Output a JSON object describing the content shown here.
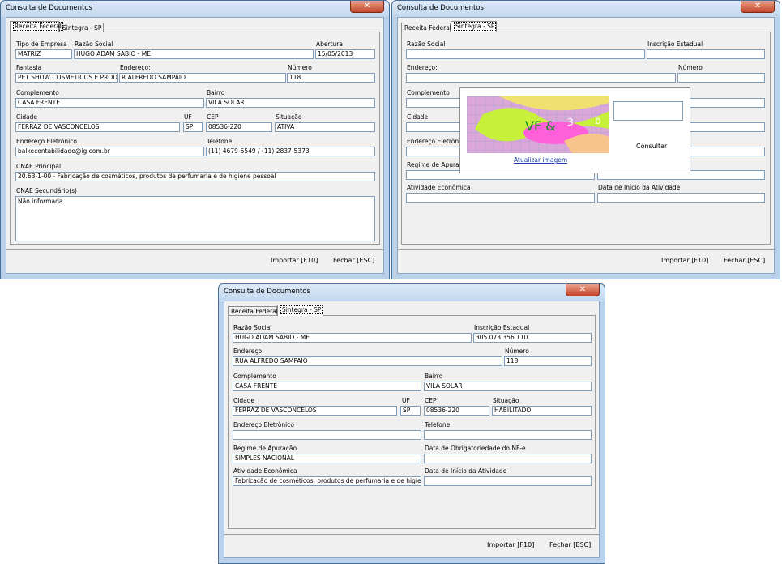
{
  "window_title": "Consulta de Documentos",
  "close_symbol": "✕",
  "tabs": {
    "receita": "Receita Federal",
    "sintegra": "Sintegra - SP"
  },
  "buttons": {
    "importar": "Importar [F10]",
    "fechar": "Fechar [ESC]",
    "consultar": "Consultar"
  },
  "captcha": {
    "link": "Atualizar imagem",
    "text": "VF &",
    "digits": "3",
    "letter": "b"
  },
  "receita": {
    "labels": {
      "tipo_empresa": "Tipo de Empresa",
      "razao_social": "Razão Social",
      "abertura": "Abertura",
      "fantasia": "Fantasia",
      "endereco": "Endereço:",
      "numero": "Número",
      "complemento": "Complemento",
      "bairro": "Bairro",
      "cidade": "Cidade",
      "uf": "UF",
      "cep": "CEP",
      "situacao": "Situação",
      "email": "Endereço Eletrônico",
      "telefone": "Telefone",
      "cnae_principal": "CNAE Principal",
      "cnae_secundario": "CNAE Secundário(s)"
    },
    "values": {
      "tipo_empresa": "MATRIZ",
      "razao_social": "HUGO ADAM SABIO - ME",
      "abertura": "15/05/2013",
      "fantasia": "PET SHOW COSMETICOS E PROD",
      "endereco": "R ALFREDO SAMPAIO",
      "numero": "118",
      "complemento": "CASA  FRENTE",
      "bairro": "VILA SOLAR",
      "cidade": "FERRAZ DE VASCONCELOS",
      "uf": "SP",
      "cep": "08536-220",
      "situacao": "ATIVA",
      "email": "balkecontabilidade@ig.com.br",
      "telefone": "(11) 4679-5549 / (11) 2837-5373",
      "cnae_principal": "20.63-1-00 - Fabricação de cosméticos, produtos de perfumaria e de higiene pessoal",
      "cnae_secundario": "Não informada"
    }
  },
  "sintegra": {
    "labels": {
      "razao_social": "Razão Social",
      "inscricao": "Inscrição Estadual",
      "endereco": "Endereço:",
      "numero": "Número",
      "complemento": "Complemento",
      "bairro": "Bairro",
      "cidade": "Cidade",
      "uf": "UF",
      "cep": "CEP",
      "situacao": "Situação",
      "email": "Endereço Eletrônico",
      "telefone": "Telefone",
      "regime": "Regime de Apuração",
      "data_obrig": "Data de Obrigatoriedade do NF-e",
      "atividade": "Atividade Econômica",
      "data_inicio": "Data de Início da Atividade"
    },
    "values": {
      "razao_social": "HUGO ADAM SABIO - ME",
      "inscricao": "305.073.356.110",
      "endereco": "RUA ALFREDO SAMPAIO",
      "numero": "118",
      "complemento": "CASA  FRENTE",
      "bairro": "VILA SOLAR",
      "cidade": "FERRAZ DE VASCONCELOS",
      "uf": "SP",
      "cep": "08536-220",
      "situacao": "HABILITADO",
      "email": "",
      "telefone": "",
      "regime": "SIMPLES NACIONAL",
      "data_obrig": "",
      "atividade": "Fabricação de cosméticos, produtos de perfumaria e de higiene pessoal",
      "data_inicio": ""
    }
  }
}
